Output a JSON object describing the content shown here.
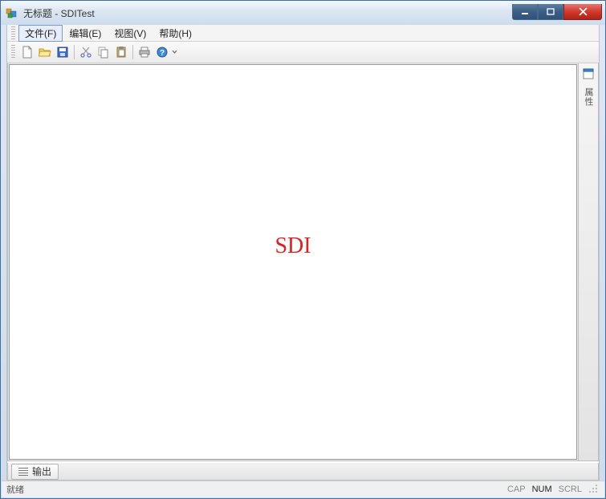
{
  "window": {
    "title": "无标题 - SDITest"
  },
  "menu": {
    "file": "文件(F)",
    "edit": "编辑(E)",
    "view": "视图(V)",
    "help": "帮助(H)"
  },
  "toolbar_icons": {
    "new": "new-file-icon",
    "open": "open-folder-icon",
    "save": "save-disk-icon",
    "cut": "cut-scissors-icon",
    "copy": "copy-icon",
    "paste": "paste-icon",
    "print": "print-icon",
    "help": "help-icon"
  },
  "document": {
    "center_text": "SDI"
  },
  "side_pane": {
    "label": "属性"
  },
  "output_tab": {
    "label": "输出"
  },
  "status": {
    "ready": "就绪",
    "cap": "CAP",
    "num": "NUM",
    "scrl": "SCRL"
  }
}
